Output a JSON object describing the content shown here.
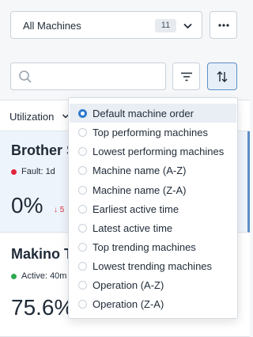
{
  "header": {
    "machine_select_label": "All Machines",
    "machine_count": "11",
    "chevron_icon": "chevron-down-icon",
    "more_icon": "more-horizontal-icon"
  },
  "toolbar": {
    "search_placeholder": "",
    "search_icon": "search-icon",
    "filter_icon": "filter-icon",
    "sort_icon": "sort-icon"
  },
  "metric_tab": {
    "label": "Utilization"
  },
  "cards": [
    {
      "name": "Brother S",
      "status": "Fault: 1d",
      "status_color": "#e0253a",
      "value": "0%",
      "delta": "↓ 5"
    },
    {
      "name": "Makino T",
      "status": "Active: 40m",
      "status_color": "#2fa84f",
      "value": "75.6%"
    }
  ],
  "sort_menu": {
    "selected_index": 0,
    "options": [
      "Default machine order",
      "Top performing machines",
      "Lowest performing machines",
      "Machine name (A-Z)",
      "Machine name (Z-A)",
      "Earliest active time",
      "Latest active time",
      "Top trending machines",
      "Lowest trending machines",
      "Operation (A-Z)",
      "Operation (Z-A)"
    ]
  },
  "colors": {
    "accent": "#2f7ad0",
    "fault": "#e0253a",
    "active": "#2fa84f"
  }
}
